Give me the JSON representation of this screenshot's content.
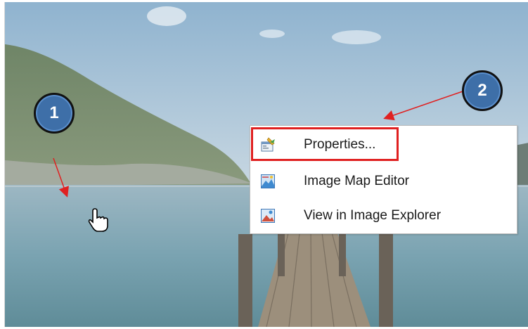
{
  "context_menu": {
    "items": [
      {
        "label": "Properties...",
        "icon": "properties-icon"
      },
      {
        "label": "Image Map Editor",
        "icon": "image-map-editor-icon"
      },
      {
        "label": "View in Image Explorer",
        "icon": "image-explorer-icon"
      }
    ]
  },
  "callouts": {
    "step1": "1",
    "step2": "2"
  },
  "colors": {
    "highlight": "#e02020",
    "badge": "#3e6fa8",
    "arrow": "#e02020"
  }
}
